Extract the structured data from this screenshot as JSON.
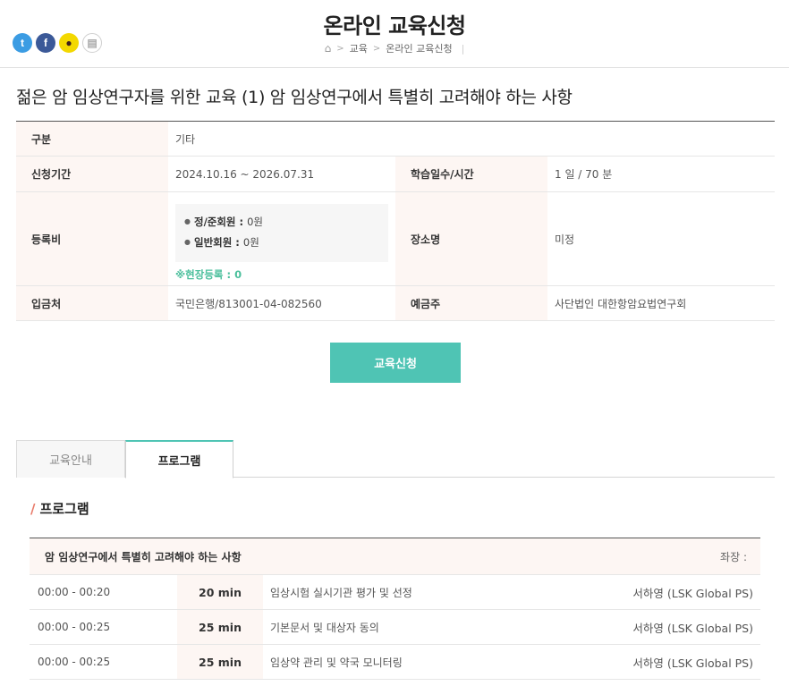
{
  "header": {
    "title": "온라인 교육신청",
    "breadcrumb": [
      "교육",
      "온라인 교육신청"
    ],
    "share_icons": [
      "twitter-icon",
      "facebook-icon",
      "kakaotalk-icon",
      "print-icon"
    ]
  },
  "course": {
    "title": "젊은 암 임상연구자를 위한 교육 (1) 암 임상연구에서 특별히 고려해야 하는 사항"
  },
  "info": {
    "category_label": "구분",
    "category_value": "기타",
    "period_label": "신청기간",
    "period_value": "2024.10.16 ~ 2026.07.31",
    "duration_label": "학습일수/시간",
    "duration_value": "1 일 / 70 분",
    "fee_label": "등록비",
    "fee_regular_label": "정/준회원 :",
    "fee_regular_value": "0원",
    "fee_general_label": "일반회원 :",
    "fee_general_value": "0원",
    "fee_onsite": "※현장등록 : 0",
    "venue_label": "장소명",
    "venue_value": "미정",
    "bank_label": "입금처",
    "bank_value": "국민은행/813001-04-082560",
    "holder_label": "예금주",
    "holder_value": "사단법인 대한항암요법연구회"
  },
  "apply_button": "교육신청",
  "tabs": [
    {
      "label": "교육안내",
      "active": false
    },
    {
      "label": "프로그램",
      "active": true
    }
  ],
  "program": {
    "heading": "프로그램",
    "session_title": "암 임상연구에서 특별히 고려해야 하는 사항",
    "chair_label": "좌장 :",
    "rows": [
      {
        "time": "00:00 - 00:20",
        "duration": "20 min",
        "topic": "임상시험 실시기관 평가 및 선정",
        "speaker": "서하영 (LSK Global PS)"
      },
      {
        "time": "00:00 - 00:25",
        "duration": "25 min",
        "topic": "기본문서 및 대상자 동의",
        "speaker": "서하영 (LSK Global PS)"
      },
      {
        "time": "00:00 - 00:25",
        "duration": "25 min",
        "topic": "임상약 관리 및 약국 모니터링",
        "speaker": "서하영 (LSK Global PS)"
      }
    ]
  },
  "colors": {
    "accent": "#4fc4b4",
    "header_cell_bg": "#fdf6f3",
    "onsite_text": "#4bbf9c"
  }
}
